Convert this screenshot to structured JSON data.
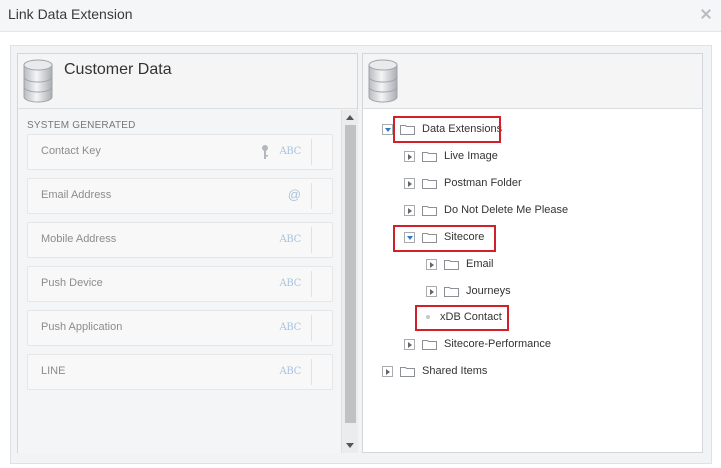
{
  "dialog": {
    "title": "Link Data Extension"
  },
  "left_panel": {
    "title": "Customer Data",
    "section_label": "SYSTEM GENERATED",
    "fields": [
      {
        "label": "Contact Key",
        "type": "ABC",
        "icon": "key-icon"
      },
      {
        "label": "Email Address",
        "type": "@",
        "icon": "at-icon"
      },
      {
        "label": "Mobile Address",
        "type": "ABC"
      },
      {
        "label": "Push Device",
        "type": "ABC"
      },
      {
        "label": "Push Application",
        "type": "ABC"
      },
      {
        "label": "LINE",
        "type": "ABC"
      }
    ]
  },
  "right_panel": {
    "title": "",
    "tree": [
      {
        "label": "Data Extensions",
        "state": "expanded",
        "highlighted": true
      },
      {
        "label": "Live Image",
        "state": "collapsed"
      },
      {
        "label": "Postman Folder",
        "state": "collapsed"
      },
      {
        "label": "Do Not Delete Me Please",
        "state": "collapsed"
      },
      {
        "label": "Sitecore",
        "state": "expanded",
        "highlighted": true
      },
      {
        "label": "Email",
        "state": "collapsed"
      },
      {
        "label": "Journeys",
        "state": "collapsed"
      },
      {
        "label": "xDB Contact",
        "state": "leaf",
        "highlighted": true
      },
      {
        "label": "Sitecore-Performance",
        "state": "collapsed"
      },
      {
        "label": "Shared Items",
        "state": "collapsed"
      }
    ]
  },
  "colors": {
    "highlight": "#d0202a",
    "type_label": "#a9c4dc",
    "toggle_arrow": "#2b7bc9"
  }
}
